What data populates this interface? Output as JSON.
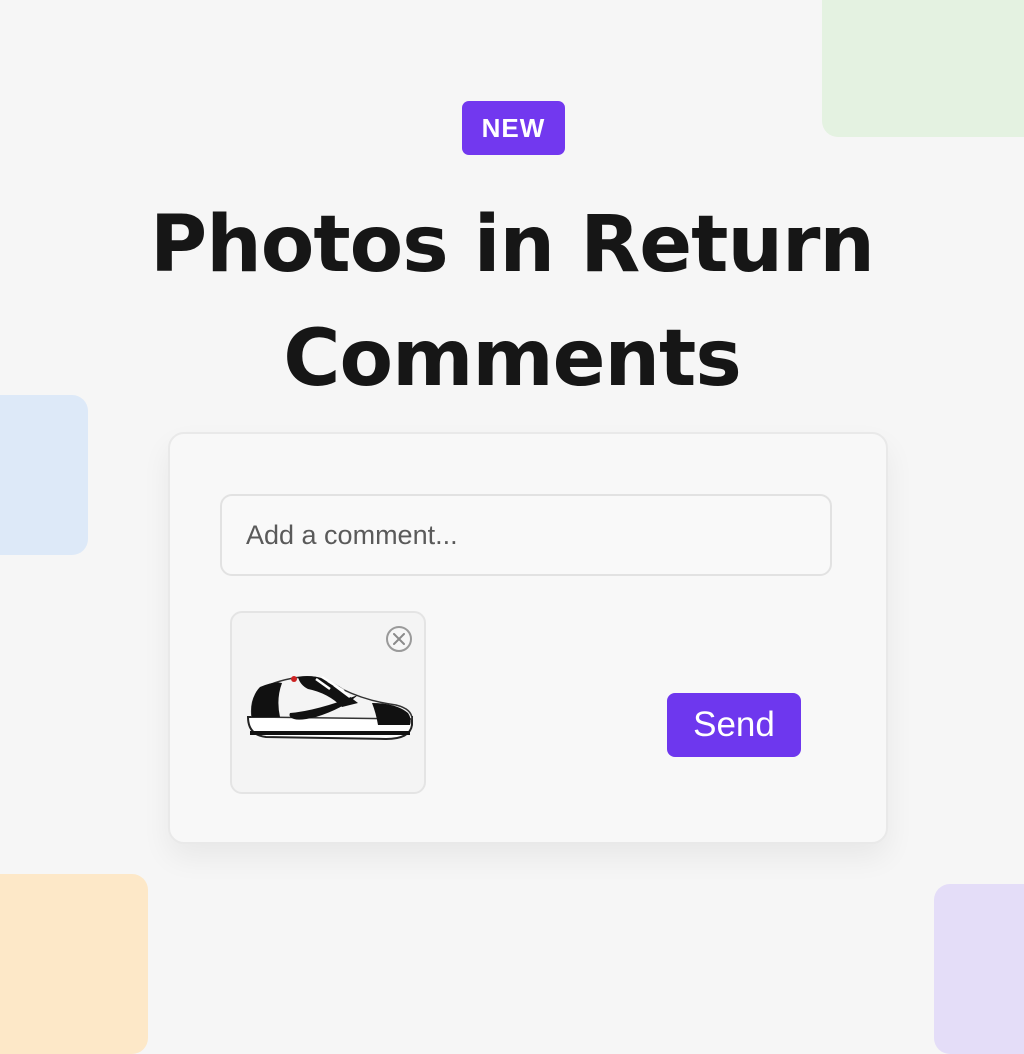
{
  "colors": {
    "accent": "#6e37ee",
    "background": "#f6f6f6",
    "title_text": "#161616"
  },
  "badge": {
    "label": "NEW"
  },
  "headline": {
    "line1": "Photos in Return",
    "line2": "Comments"
  },
  "comment_box": {
    "placeholder": "Add a comment...",
    "value": ""
  },
  "attachment": {
    "image_icon": "sneaker-image",
    "remove_icon": "close-circle-icon"
  },
  "send_button": {
    "label": "Send"
  }
}
